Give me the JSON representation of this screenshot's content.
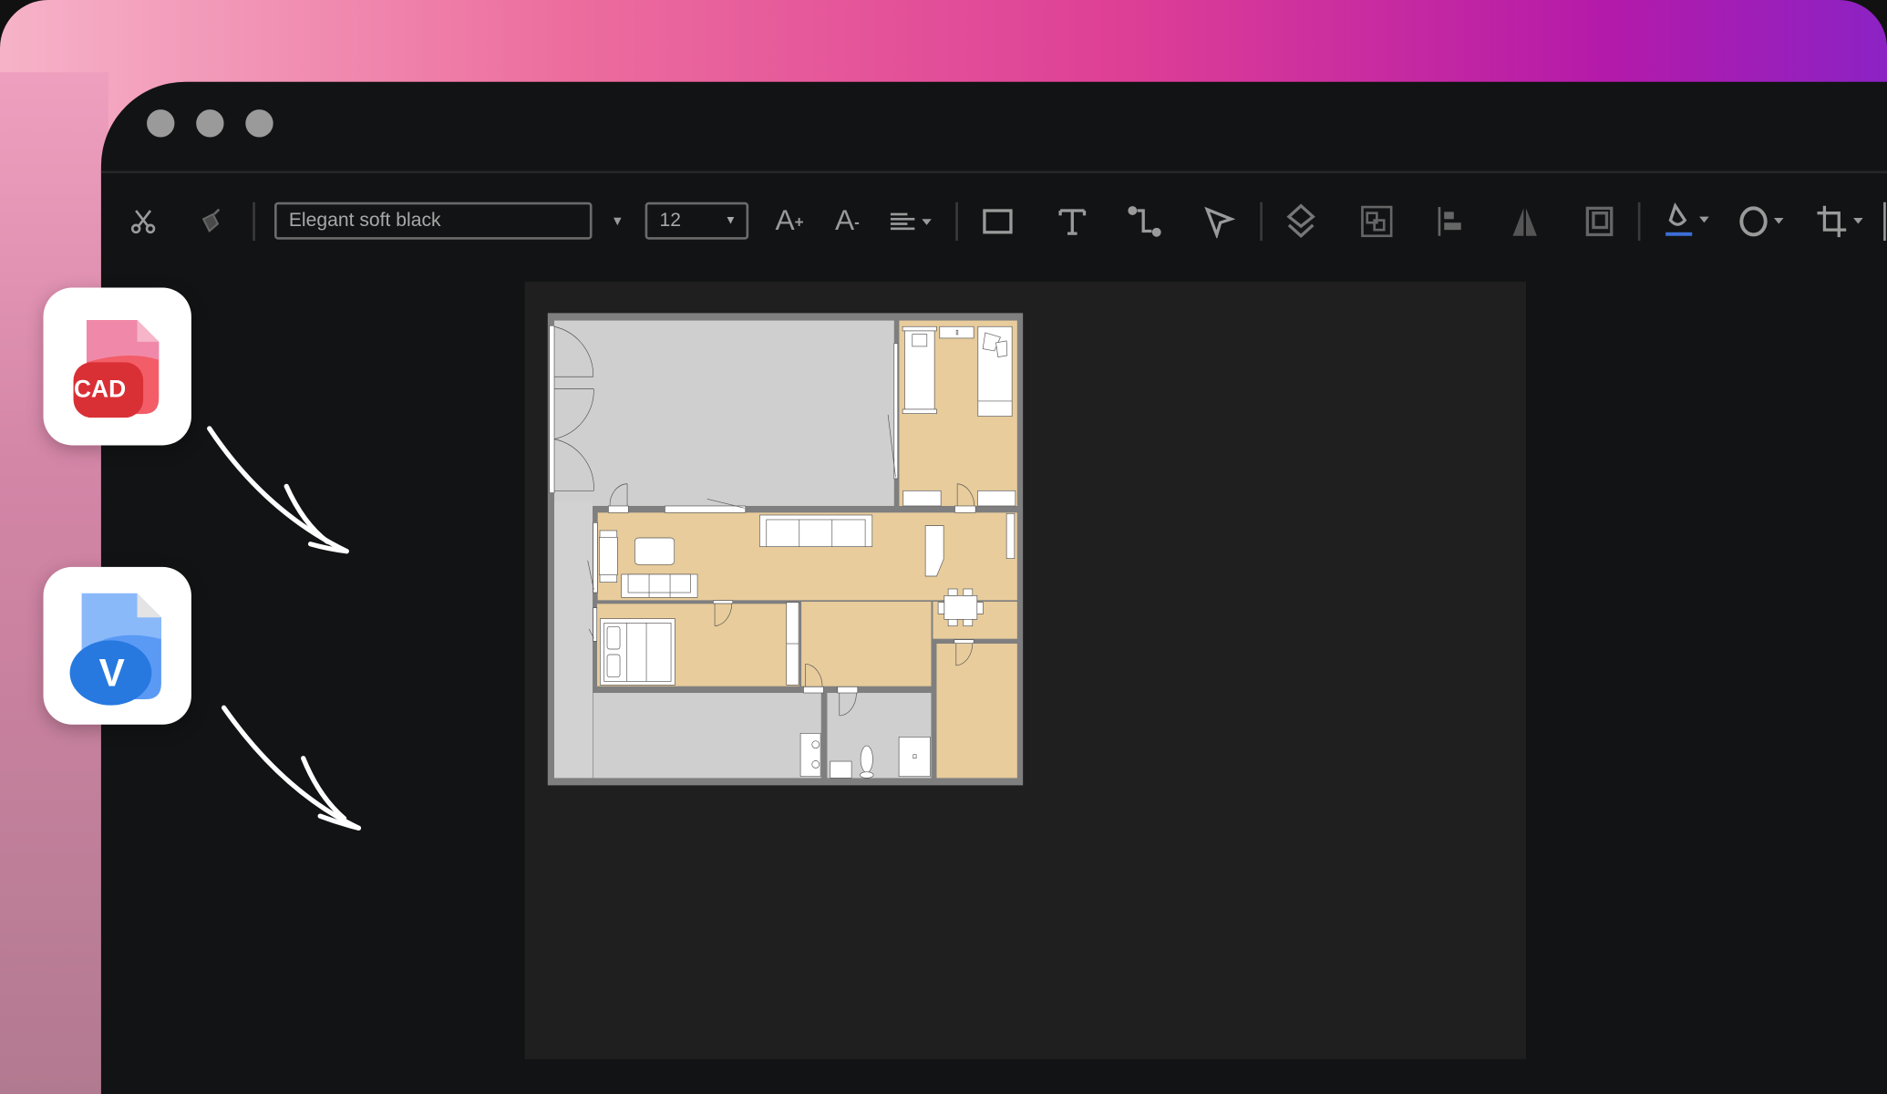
{
  "window": {
    "controls": [
      "close",
      "minimize",
      "maximize"
    ]
  },
  "toolbar": {
    "font_name": "Elegant soft black",
    "font_size": "12",
    "icons": [
      "scissors-icon",
      "format-painter-icon",
      "font-increase-icon",
      "font-decrease-icon",
      "align-icon",
      "rectangle-icon",
      "text-icon",
      "connector-icon",
      "pointer-icon",
      "layers-icon",
      "group-icon",
      "align-left-icon",
      "flip-icon",
      "frame-icon",
      "fill-icon",
      "shape-icon",
      "crop-icon"
    ],
    "fill_accent": "#3a6fd8"
  },
  "import_cards": [
    {
      "label": "CAD",
      "color": "#e8394a"
    },
    {
      "label": "V",
      "color": "#2b7be0"
    }
  ],
  "floorplan": {
    "floor_color": "#e8cc9c",
    "room_gray": "#cfcfcf",
    "wall_color": "#7f7f7f"
  }
}
